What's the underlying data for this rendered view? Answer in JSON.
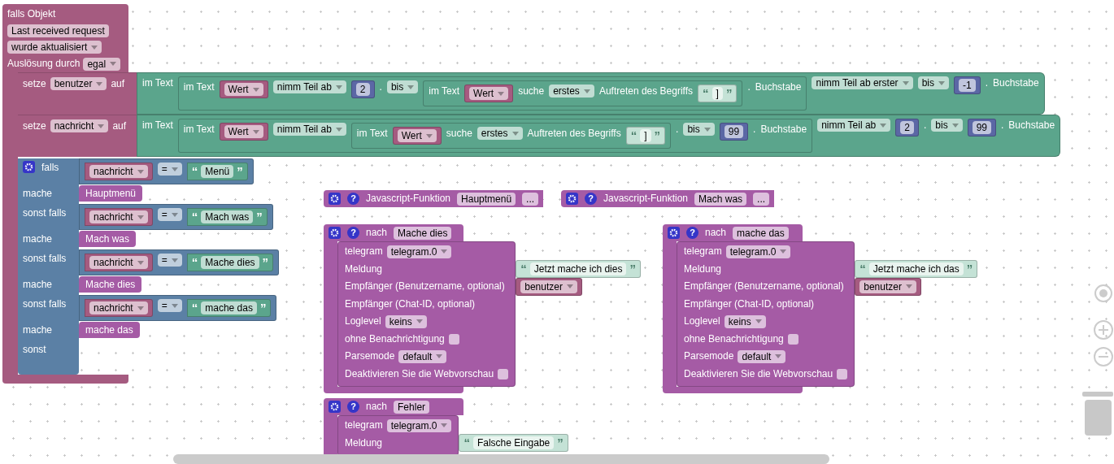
{
  "event": {
    "title": "falls Objekt",
    "object": "Last received request",
    "trigger": "wurde aktualisiert",
    "cause_label": "Auslösung durch",
    "cause": "egal",
    "statements": [
      {
        "keyword": "setze",
        "variable": "benutzer",
        "to": "auf",
        "value": {
          "kind": "text_block",
          "items": [
            {
              "kind": "label",
              "text": "im Text"
            },
            {
              "kind": "text_block",
              "items": [
                {
                  "kind": "label",
                  "text": "im Text"
                },
                {
                  "kind": "variable",
                  "text": "Wert"
                },
                {
                  "kind": "dropdown",
                  "text": "nimm Teil ab"
                },
                {
                  "kind": "number",
                  "text": "2"
                },
                {
                  "kind": "label",
                  "text": "."
                },
                {
                  "kind": "dropdown",
                  "text": "bis"
                },
                {
                  "kind": "text_block",
                  "items": [
                    {
                      "kind": "label",
                      "text": "im Text"
                    },
                    {
                      "kind": "variable",
                      "text": "Wert"
                    },
                    {
                      "kind": "label",
                      "text": "suche"
                    },
                    {
                      "kind": "dropdown",
                      "text": "erstes"
                    },
                    {
                      "kind": "label",
                      "text": "Auftreten des Begriffs"
                    },
                    {
                      "kind": "string",
                      "open": "“",
                      "text": "]",
                      "close": "”",
                      "shadow": true
                    }
                  ]
                },
                {
                  "kind": "label",
                  "text": "."
                },
                {
                  "kind": "label",
                  "text": "Buchstabe"
                }
              ]
            },
            {
              "kind": "dropdown",
              "text": "nimm Teil ab erster"
            },
            {
              "kind": "dropdown",
              "text": "bis"
            },
            {
              "kind": "number",
              "text": "-1"
            },
            {
              "kind": "label",
              "text": "."
            },
            {
              "kind": "label",
              "text": "Buchstabe"
            }
          ]
        }
      },
      {
        "keyword": "setze",
        "variable": "nachricht",
        "to": "auf",
        "value": {
          "kind": "text_block",
          "items": [
            {
              "kind": "label",
              "text": "im Text"
            },
            {
              "kind": "text_block",
              "items": [
                {
                  "kind": "label",
                  "text": "im Text"
                },
                {
                  "kind": "variable",
                  "text": "Wert"
                },
                {
                  "kind": "dropdown",
                  "text": "nimm Teil ab"
                },
                {
                  "kind": "text_block",
                  "items": [
                    {
                      "kind": "label",
                      "text": "im Text"
                    },
                    {
                      "kind": "variable",
                      "text": "Wert"
                    },
                    {
                      "kind": "label",
                      "text": "suche"
                    },
                    {
                      "kind": "dropdown",
                      "text": "erstes"
                    },
                    {
                      "kind": "label",
                      "text": "Auftreten des Begriffs"
                    },
                    {
                      "kind": "string",
                      "open": "“",
                      "text": "]",
                      "close": "”",
                      "shadow": true
                    }
                  ]
                },
                {
                  "kind": "label",
                  "text": "."
                },
                {
                  "kind": "dropdown",
                  "text": "bis"
                },
                {
                  "kind": "number",
                  "text": "99"
                },
                {
                  "kind": "label",
                  "text": "."
                },
                {
                  "kind": "label",
                  "text": "Buchstabe"
                }
              ]
            },
            {
              "kind": "dropdown",
              "text": "nimm Teil ab"
            },
            {
              "kind": "number",
              "text": "2"
            },
            {
              "kind": "label",
              "text": "."
            },
            {
              "kind": "dropdown",
              "text": "bis"
            },
            {
              "kind": "number",
              "text": "99"
            },
            {
              "kind": "label",
              "text": "."
            },
            {
              "kind": "label",
              "text": "Buchstabe"
            }
          ]
        }
      }
    ],
    "if_block": {
      "branches": [
        {
          "keyword": "falls",
          "condition": {
            "kind": "logic_block",
            "items": [
              {
                "kind": "variable",
                "text": "nachricht"
              },
              {
                "kind": "dropdown",
                "text": "="
              },
              {
                "kind": "string",
                "open": "“",
                "text": "Menü",
                "close": "”",
                "shadow": false
              }
            ]
          },
          "do_label": "mache",
          "call": "Hauptmenü"
        },
        {
          "keyword": "sonst falls",
          "condition": {
            "kind": "logic_block",
            "items": [
              {
                "kind": "variable",
                "text": "nachricht"
              },
              {
                "kind": "dropdown",
                "text": "="
              },
              {
                "kind": "string",
                "open": "“",
                "text": "Mach was",
                "close": "”",
                "shadow": false
              }
            ]
          },
          "do_label": "mache",
          "call": "Mach was"
        },
        {
          "keyword": "sonst falls",
          "condition": {
            "kind": "logic_block",
            "items": [
              {
                "kind": "variable",
                "text": "nachricht"
              },
              {
                "kind": "dropdown",
                "text": "="
              },
              {
                "kind": "string",
                "open": "“",
                "text": "Mache dies",
                "close": "”",
                "shadow": false
              }
            ]
          },
          "do_label": "mache",
          "call": "Mache dies"
        },
        {
          "keyword": "sonst falls",
          "condition": {
            "kind": "logic_block",
            "items": [
              {
                "kind": "variable",
                "text": "nachricht"
              },
              {
                "kind": "dropdown",
                "text": "="
              },
              {
                "kind": "string",
                "open": "“",
                "text": "mache das",
                "close": "”",
                "shadow": false
              }
            ]
          },
          "do_label": "mache",
          "call": "mache das"
        }
      ],
      "else_label": "sonst"
    }
  },
  "functions": [
    {
      "help": "?",
      "label": "Javascript-Funktion",
      "name": "Hauptmenü",
      "more": "..."
    },
    {
      "help": "?",
      "label": "Javascript-Funktion",
      "name": "Mach was",
      "more": "..."
    }
  ],
  "procedures": [
    {
      "help": "?",
      "keyword": "nach",
      "name": "Mache dies",
      "rows": [
        {
          "kind": "dropdown",
          "label": "telegram",
          "value": "telegram.0"
        },
        {
          "kind": "input",
          "label": "Meldung",
          "attached": {
            "kind": "string",
            "open": "“",
            "text": "Jetzt mache ich dies",
            "close": "”",
            "shadow": true
          }
        },
        {
          "kind": "input",
          "label": "Empfänger (Benutzername, optional)",
          "attached": {
            "kind": "variable",
            "text": "benutzer"
          }
        },
        {
          "kind": "input",
          "label": "Empfänger (Chat-ID, optional)"
        },
        {
          "kind": "dropdown",
          "label": "Loglevel",
          "value": "keins"
        },
        {
          "kind": "checkbox",
          "label": "ohne Benachrichtigung",
          "checked": false
        },
        {
          "kind": "dropdown",
          "label": "Parsemode",
          "value": "default"
        },
        {
          "kind": "checkbox",
          "label": "Deaktivieren Sie die Webvorschau",
          "checked": false
        }
      ]
    },
    {
      "help": "?",
      "keyword": "nach",
      "name": "mache das",
      "rows": [
        {
          "kind": "dropdown",
          "label": "telegram",
          "value": "telegram.0"
        },
        {
          "kind": "input",
          "label": "Meldung",
          "attached": {
            "kind": "string",
            "open": "“",
            "text": "Jetzt mache ich das",
            "close": "”",
            "shadow": true
          }
        },
        {
          "kind": "input",
          "label": "Empfänger (Benutzername, optional)",
          "attached": {
            "kind": "variable",
            "text": "benutzer"
          }
        },
        {
          "kind": "input",
          "label": "Empfänger (Chat-ID, optional)"
        },
        {
          "kind": "dropdown",
          "label": "Loglevel",
          "value": "keins"
        },
        {
          "kind": "checkbox",
          "label": "ohne Benachrichtigung",
          "checked": false
        },
        {
          "kind": "dropdown",
          "label": "Parsemode",
          "value": "default"
        },
        {
          "kind": "checkbox",
          "label": "Deaktivieren Sie die Webvorschau",
          "checked": false
        }
      ]
    },
    {
      "help": "?",
      "keyword": "nach",
      "name": "Fehler",
      "rows": [
        {
          "kind": "dropdown",
          "label": "telegram",
          "value": "telegram.0"
        },
        {
          "kind": "input",
          "label": "Meldung",
          "attached": {
            "kind": "string",
            "open": "“",
            "text": "Falsche Eingabe",
            "close": "”",
            "shadow": true
          }
        }
      ]
    }
  ]
}
